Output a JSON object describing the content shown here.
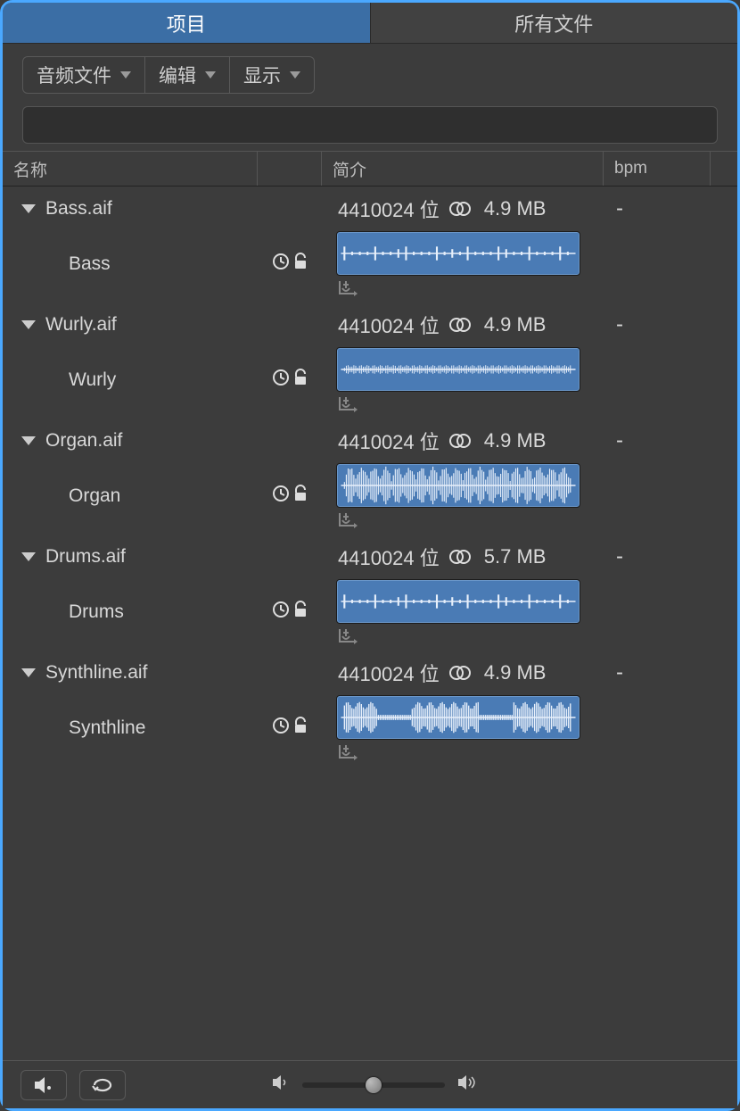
{
  "tabs": {
    "project": "项目",
    "all_files": "所有文件"
  },
  "menus": {
    "audio": "音频文件",
    "edit": "编辑",
    "view": "显示"
  },
  "search_placeholder": "",
  "columns": {
    "name": "名称",
    "info": "简介",
    "bpm": "bpm"
  },
  "files": [
    {
      "filename": "Bass.aif",
      "spec": "4410024 位",
      "size": "4.9 MB",
      "bpm": "-",
      "region": "Bass",
      "wave": "sparse"
    },
    {
      "filename": "Wurly.aif",
      "spec": "4410024 位",
      "size": "4.9 MB",
      "bpm": "-",
      "region": "Wurly",
      "wave": "fine"
    },
    {
      "filename": "Organ.aif",
      "spec": "4410024 位",
      "size": "4.9 MB",
      "bpm": "-",
      "region": "Organ",
      "wave": "dense"
    },
    {
      "filename": "Drums.aif",
      "spec": "4410024 位",
      "size": "5.7 MB",
      "bpm": "-",
      "region": "Drums",
      "wave": "sparse"
    },
    {
      "filename": "Synthline.aif",
      "spec": "4410024 位",
      "size": "4.9 MB",
      "bpm": "-",
      "region": "Synthline",
      "wave": "blocks"
    }
  ]
}
